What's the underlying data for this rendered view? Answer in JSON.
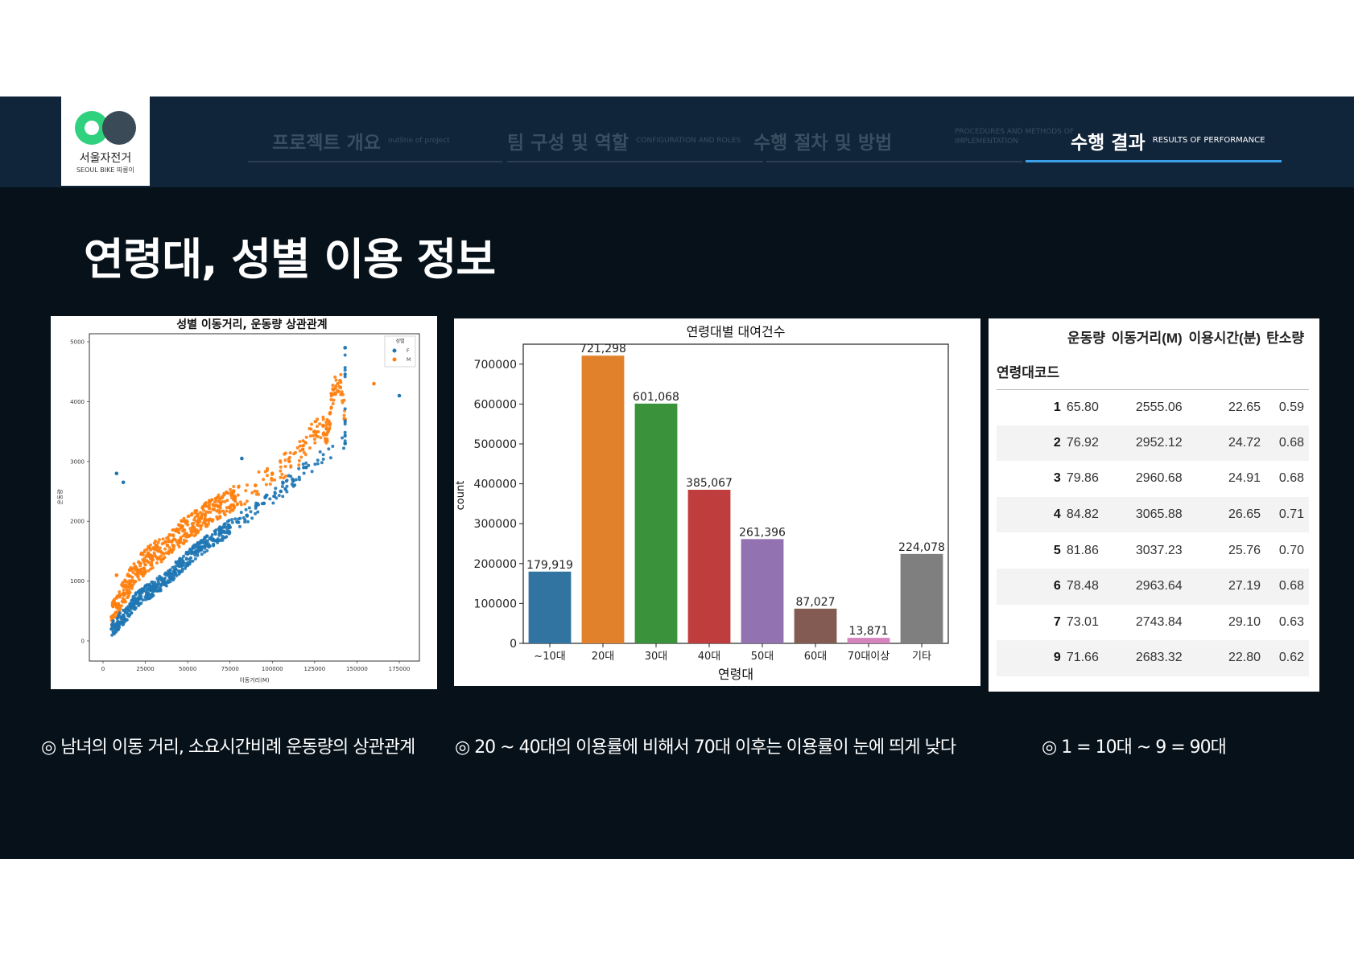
{
  "logo": {
    "name": "서울자전거",
    "sub": "SEOUL BIKE 따릉이"
  },
  "nav": [
    {
      "ko": "프로젝트 개요",
      "en": "outline of project"
    },
    {
      "ko": "팀 구성 및 역할",
      "en": "CONFIGURATION AND ROLES"
    },
    {
      "ko": "수행 절차 및 방법",
      "en": "PROCEDURES AND METHODS OF IMPLEMENTATION"
    },
    {
      "ko": "수행 결과",
      "en": "RESULTS OF PERFORMANCE"
    }
  ],
  "title": "연령대, 성별 이용 정보",
  "colors": {
    "female": "#1f77b4",
    "male": "#ff7f0e",
    "active_underline": "#3aa0e8"
  },
  "chart_data": [
    {
      "type": "scatter",
      "title": "성별 이동거리, 운동량 상관관계",
      "xlabel": "이동거리(M)",
      "ylabel": "운동량",
      "xlim": [
        0,
        175000
      ],
      "ylim": [
        0,
        5000
      ],
      "xticks": [
        "0",
        "25000",
        "50000",
        "75000",
        "100000",
        "125000",
        "150000",
        "175000"
      ],
      "yticks": [
        "0",
        "1000",
        "2000",
        "3000",
        "4000",
        "5000"
      ],
      "legend": {
        "title": "성별",
        "placement": "top-right",
        "entries": [
          "F",
          "M"
        ]
      },
      "series": [
        {
          "name": "F",
          "points": [
            [
              5000,
              200
            ],
            [
              12000,
              400
            ],
            [
              20000,
              700
            ],
            [
              28000,
              850
            ],
            [
              36000,
              1000
            ],
            [
              45000,
              1250
            ],
            [
              55000,
              1500
            ],
            [
              65000,
              1700
            ],
            [
              75000,
              1900
            ],
            [
              85000,
              2100
            ],
            [
              95000,
              2300
            ],
            [
              105000,
              2500
            ],
            [
              112000,
              2700
            ],
            [
              120000,
              2900
            ],
            [
              143000,
              3300
            ],
            [
              143000,
              4900
            ],
            [
              175000,
              4100
            ],
            [
              8000,
              2800
            ],
            [
              12000,
              2650
            ],
            [
              82000,
              3050
            ]
          ]
        },
        {
          "name": "M",
          "points": [
            [
              5000,
              400
            ],
            [
              12000,
              800
            ],
            [
              20000,
              1200
            ],
            [
              28000,
              1400
            ],
            [
              38000,
              1600
            ],
            [
              48000,
              1850
            ],
            [
              58000,
              2050
            ],
            [
              68000,
              2250
            ],
            [
              78000,
              2400
            ],
            [
              90000,
              2600
            ],
            [
              100000,
              2800
            ],
            [
              110000,
              3000
            ],
            [
              118000,
              3200
            ],
            [
              125000,
              3500
            ],
            [
              130000,
              3600
            ],
            [
              132000,
              3450
            ],
            [
              134000,
              3800
            ],
            [
              136000,
              4200
            ],
            [
              140000,
              4350
            ],
            [
              143000,
              3700
            ],
            [
              160000,
              4300
            ],
            [
              8000,
              1100
            ]
          ]
        }
      ]
    },
    {
      "type": "bar",
      "title": "연령대별 대여건수",
      "xlabel": "연령대",
      "ylabel": "count",
      "ylim": [
        0,
        750000
      ],
      "yticks": [
        "0",
        "100000",
        "200000",
        "300000",
        "400000",
        "500000",
        "600000",
        "700000"
      ],
      "categories": [
        "~10대",
        "20대",
        "30대",
        "40대",
        "50대",
        "60대",
        "70대이상",
        "기타"
      ],
      "values": [
        179919,
        721298,
        601068,
        385067,
        261396,
        87027,
        13871,
        224078
      ],
      "labels": [
        "179,919",
        "721,298",
        "601,068",
        "385,067",
        "261,396",
        "87,027",
        "13,871",
        "224,078"
      ],
      "colors": [
        "#3274a1",
        "#e1812c",
        "#3a923a",
        "#c03d3e",
        "#9372b2",
        "#845b53",
        "#d684bd",
        "#7f7f7f"
      ]
    },
    {
      "type": "table",
      "index_name": "연령대코드",
      "columns": [
        "운동량",
        "이동거리(M)",
        "이용시간(분)",
        "탄소량"
      ],
      "rows": [
        [
          "1",
          "65.80",
          "2555.06",
          "22.65",
          "0.59"
        ],
        [
          "2",
          "76.92",
          "2952.12",
          "24.72",
          "0.68"
        ],
        [
          "3",
          "79.86",
          "2960.68",
          "24.91",
          "0.68"
        ],
        [
          "4",
          "84.82",
          "3065.88",
          "26.65",
          "0.71"
        ],
        [
          "5",
          "81.86",
          "3037.23",
          "25.76",
          "0.70"
        ],
        [
          "6",
          "78.48",
          "2963.64",
          "27.19",
          "0.68"
        ],
        [
          "7",
          "73.01",
          "2743.84",
          "29.10",
          "0.63"
        ],
        [
          "9",
          "71.66",
          "2683.32",
          "22.80",
          "0.62"
        ]
      ]
    }
  ],
  "captions": [
    "◎ 남녀의 이동 거리, 소요시간비례 운동량의 상관관계",
    "◎ 20 ~ 40대의 이용률에 비해서 70대 이후는 이용률이 눈에 띄게 낮다",
    "◎ 1 = 10대 ~ 9 = 90대"
  ]
}
